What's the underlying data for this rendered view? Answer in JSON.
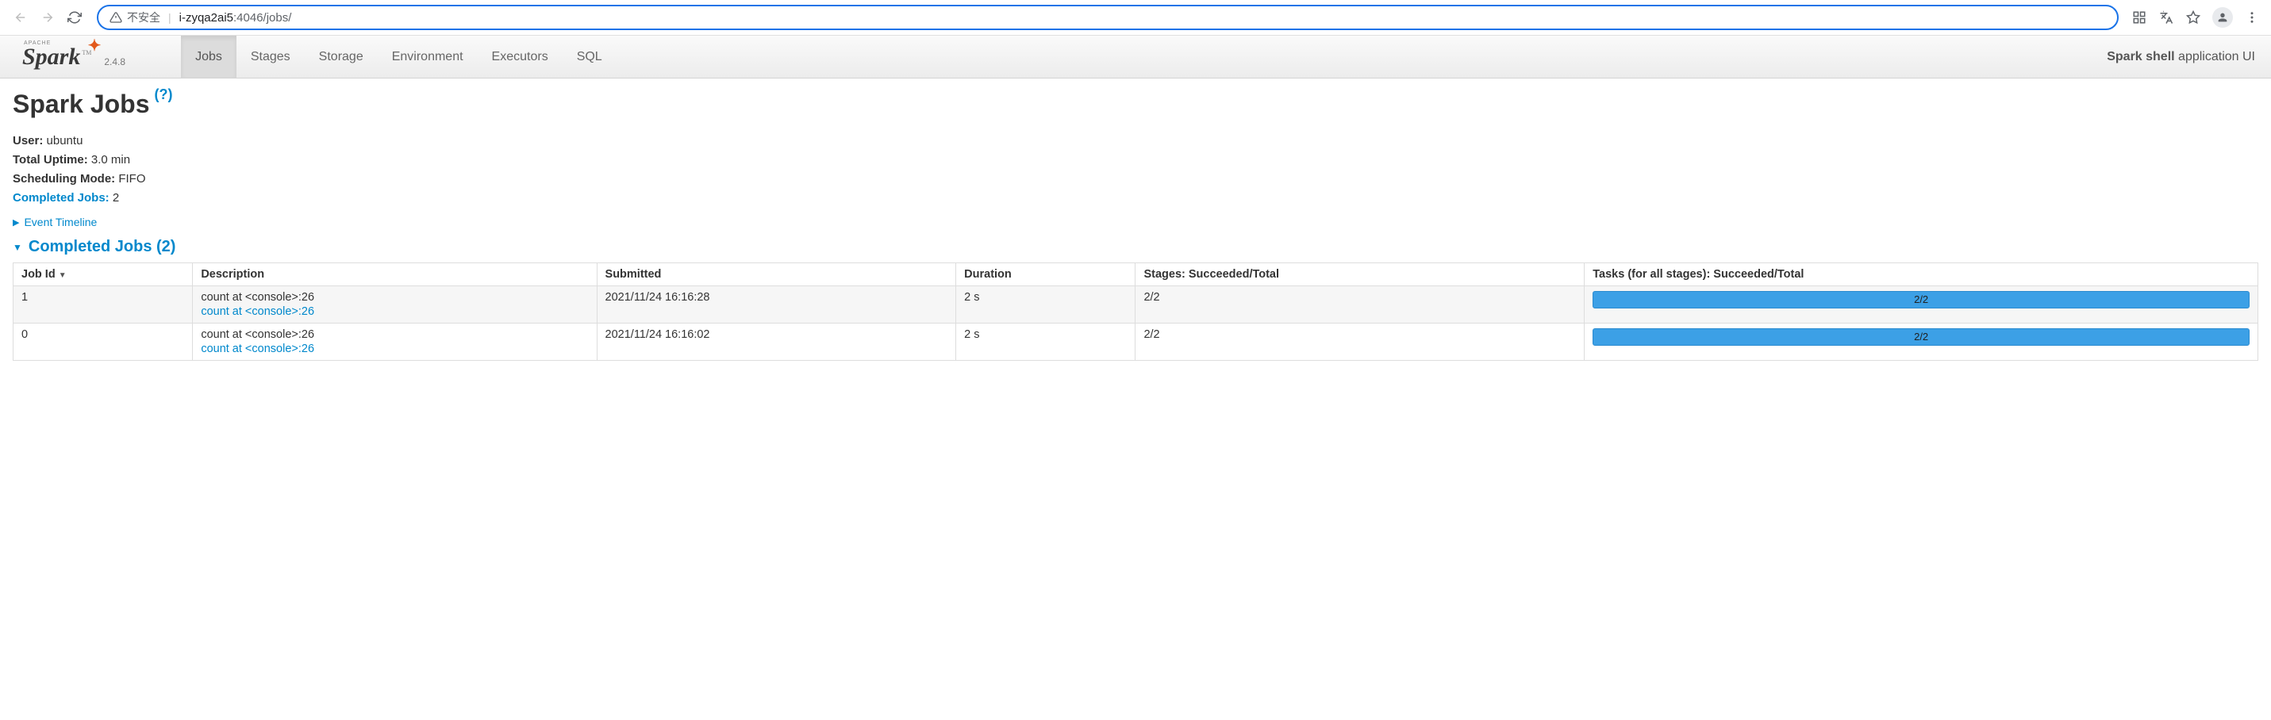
{
  "browser": {
    "insecure_label": "不安全",
    "url_host": "i-zyqa2ai5",
    "url_port_path": ":4046/jobs/"
  },
  "brand": {
    "apache": "APACHE",
    "name": "Spark",
    "tm": "TM",
    "version": "2.4.8"
  },
  "nav": {
    "tabs": [
      "Jobs",
      "Stages",
      "Storage",
      "Environment",
      "Executors",
      "SQL"
    ],
    "app_name": "Spark shell",
    "app_suffix": "application UI"
  },
  "page": {
    "title": "Spark Jobs",
    "help": "(?)"
  },
  "summary": {
    "user_label": "User:",
    "user_value": "ubuntu",
    "uptime_label": "Total Uptime:",
    "uptime_value": "3.0 min",
    "scheduling_label": "Scheduling Mode:",
    "scheduling_value": "FIFO",
    "completed_label": "Completed Jobs:",
    "completed_value": "2"
  },
  "event_timeline": "Event Timeline",
  "section": {
    "completed_jobs": "Completed Jobs (2)"
  },
  "table": {
    "headers": {
      "job_id": "Job Id",
      "description": "Description",
      "submitted": "Submitted",
      "duration": "Duration",
      "stages": "Stages: Succeeded/Total",
      "tasks": "Tasks (for all stages): Succeeded/Total"
    },
    "rows": [
      {
        "job_id": "1",
        "desc": "count at <console>:26",
        "desc_link": "count at <console>:26",
        "submitted": "2021/11/24 16:16:28",
        "duration": "2 s",
        "stages": "2/2",
        "tasks": "2/2"
      },
      {
        "job_id": "0",
        "desc": "count at <console>:26",
        "desc_link": "count at <console>:26",
        "submitted": "2021/11/24 16:16:02",
        "duration": "2 s",
        "stages": "2/2",
        "tasks": "2/2"
      }
    ]
  }
}
